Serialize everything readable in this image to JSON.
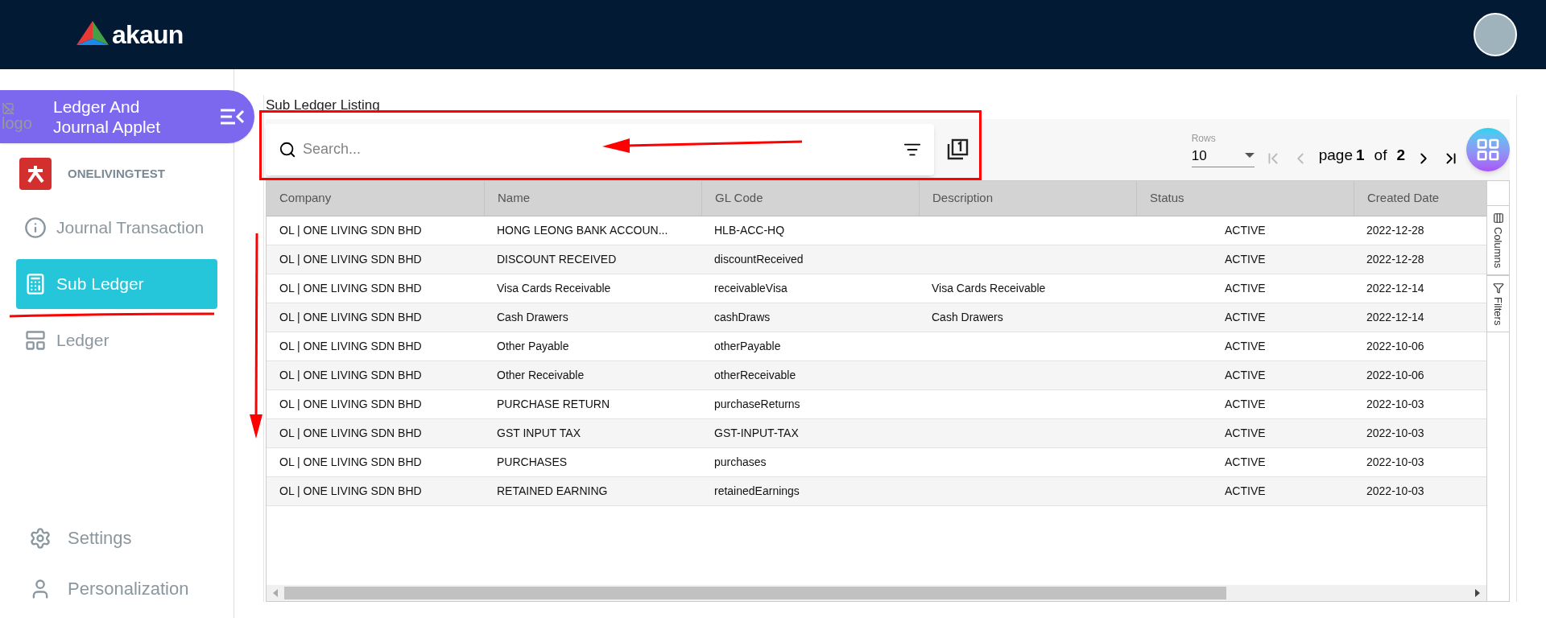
{
  "header": {
    "brand": "akaun"
  },
  "sidebar": {
    "applet": {
      "logo_alt": "logo",
      "title": "Ledger And Journal Applet"
    },
    "company": "ONELIVINGTEST",
    "items": [
      {
        "label": "Journal Transaction",
        "selected": false
      },
      {
        "label": "Sub Ledger",
        "selected": true
      },
      {
        "label": "Ledger",
        "selected": false
      }
    ],
    "bottom_items": [
      {
        "label": "Settings"
      },
      {
        "label": "Personalization"
      }
    ]
  },
  "page": {
    "title": "Sub Ledger Listing",
    "search": {
      "placeholder": "Search..."
    },
    "pagination": {
      "rows_label": "Rows",
      "rows_value": "10",
      "page_word": "page",
      "page": "1",
      "of_word": "of",
      "total": "2"
    }
  },
  "table": {
    "columns": [
      "Company",
      "Name",
      "GL Code",
      "Description",
      "Status",
      "Created Date"
    ],
    "rows": [
      {
        "company": "OL | ONE LIVING SDN BHD",
        "name": "HONG LEONG BANK ACCOUN...",
        "gl_code": "HLB-ACC-HQ",
        "status": "ACTIVE",
        "created_date": "2022-12-28"
      },
      {
        "company": "OL | ONE LIVING SDN BHD",
        "name": "DISCOUNT RECEIVED",
        "gl_code": "discountReceived",
        "status": "ACTIVE",
        "created_date": "2022-12-28"
      },
      {
        "company": "OL | ONE LIVING SDN BHD",
        "name": "Visa Cards Receivable",
        "gl_code": "receivableVisa",
        "description": "Visa Cards Receivable",
        "status": "ACTIVE",
        "created_date": "2022-12-14"
      },
      {
        "company": "OL | ONE LIVING SDN BHD",
        "name": "Cash Drawers",
        "gl_code": "cashDraws",
        "description": "Cash Drawers",
        "status": "ACTIVE",
        "created_date": "2022-12-14"
      },
      {
        "company": "OL | ONE LIVING SDN BHD",
        "name": "Other Payable",
        "gl_code": "otherPayable",
        "status": "ACTIVE",
        "created_date": "2022-10-06"
      },
      {
        "company": "OL | ONE LIVING SDN BHD",
        "name": "Other Receivable",
        "gl_code": "otherReceivable",
        "status": "ACTIVE",
        "created_date": "2022-10-06"
      },
      {
        "company": "OL | ONE LIVING SDN BHD",
        "name": "PURCHASE RETURN",
        "gl_code": "purchaseReturns",
        "status": "ACTIVE",
        "created_date": "2022-10-03"
      },
      {
        "company": "OL | ONE LIVING SDN BHD",
        "name": "GST INPUT TAX",
        "gl_code": "GST-INPUT-TAX",
        "status": "ACTIVE",
        "created_date": "2022-10-03"
      },
      {
        "company": "OL | ONE LIVING SDN BHD",
        "name": "PURCHASES",
        "gl_code": "purchases",
        "status": "ACTIVE",
        "created_date": "2022-10-03"
      },
      {
        "company": "OL | ONE LIVING SDN BHD",
        "name": "RETAINED EARNING",
        "gl_code": "retainedEarnings",
        "status": "ACTIVE",
        "created_date": "2022-10-03"
      }
    ],
    "side_tabs": [
      "Columns",
      "Filters"
    ]
  }
}
